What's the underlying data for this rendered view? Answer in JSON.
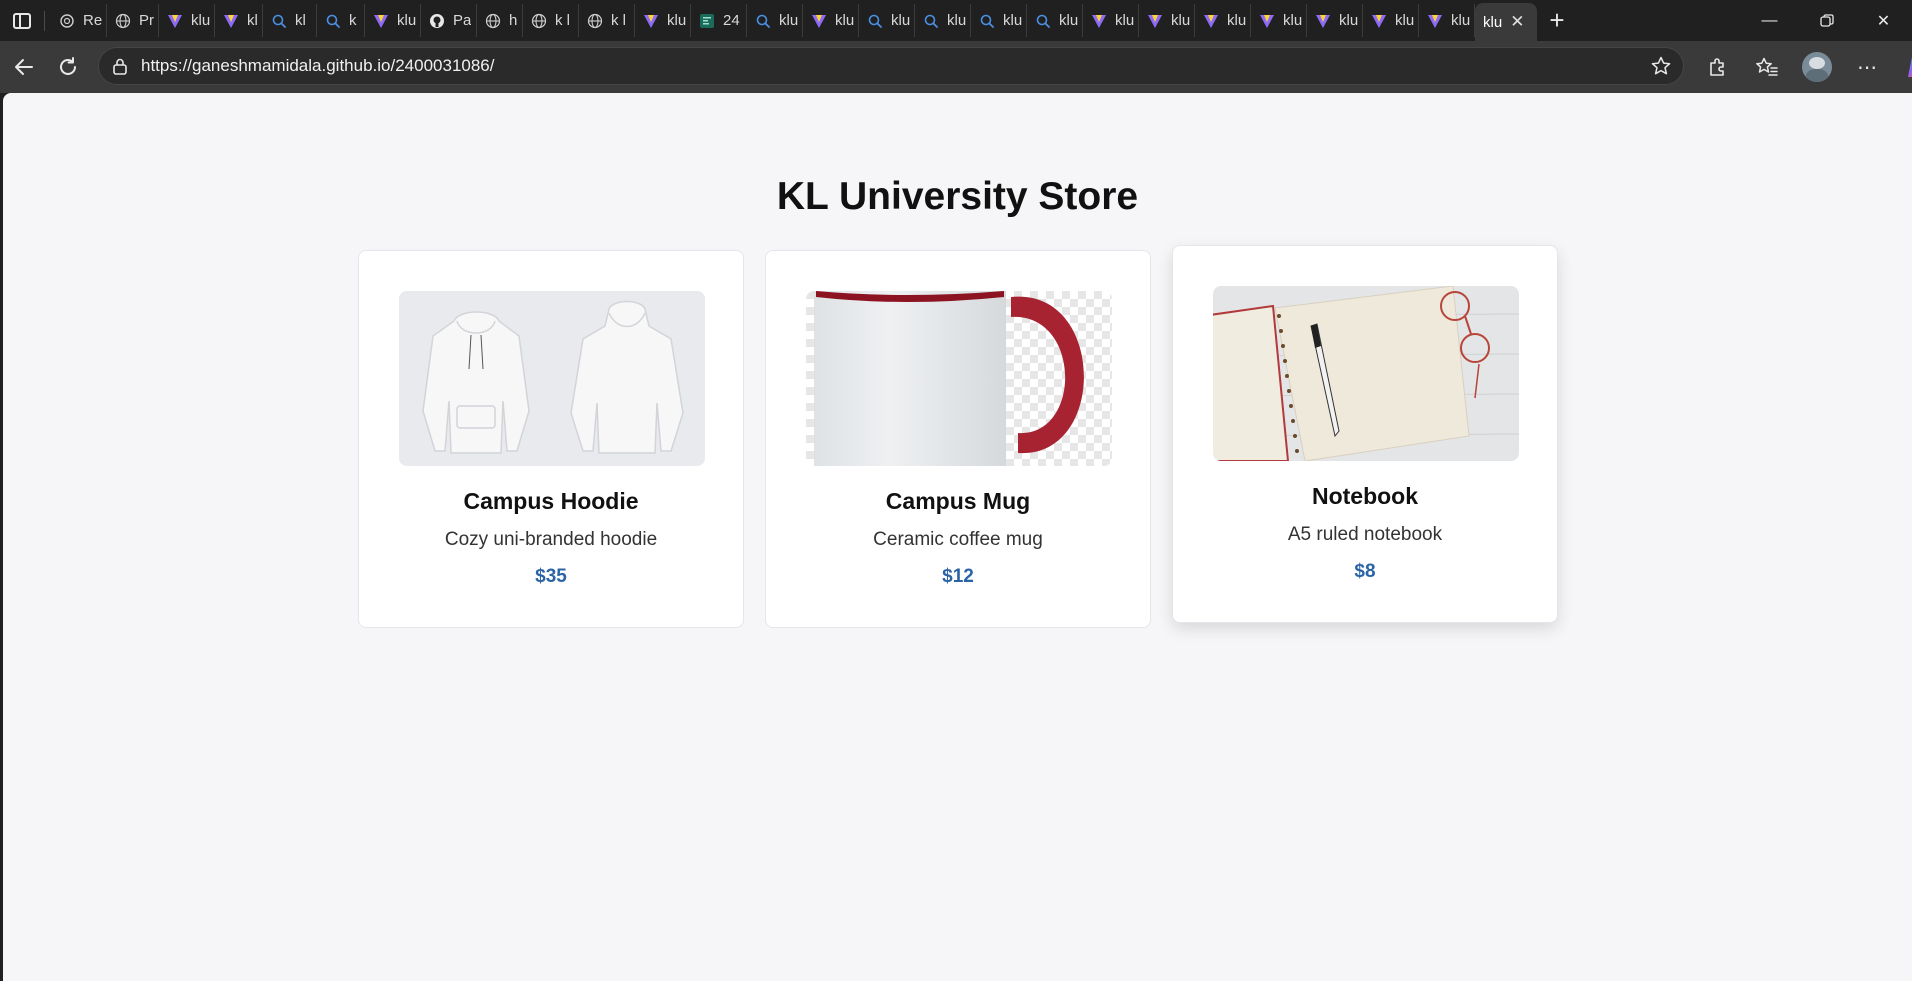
{
  "browser": {
    "tabs": [
      {
        "label": "Re",
        "icon": "openai-icon"
      },
      {
        "label": "Pro",
        "icon": "globe-icon"
      },
      {
        "label": "klu",
        "icon": "vite-icon"
      },
      {
        "label": "klu",
        "icon": "vite-icon"
      },
      {
        "label": "kl",
        "icon": "search-icon"
      },
      {
        "label": "k l",
        "icon": "search-icon"
      },
      {
        "label": "klu",
        "icon": "vite-icon"
      },
      {
        "label": "Pa",
        "icon": "github-icon"
      },
      {
        "label": "ho",
        "icon": "globe-icon"
      },
      {
        "label": "k l",
        "icon": "globe-icon"
      },
      {
        "label": "k l",
        "icon": "globe-icon"
      },
      {
        "label": "klu",
        "icon": "vite-icon"
      },
      {
        "label": "24",
        "icon": "sheet-icon"
      },
      {
        "label": "klu",
        "icon": "search-icon"
      },
      {
        "label": "klu",
        "icon": "vite-icon"
      },
      {
        "label": "klu",
        "icon": "search-icon"
      },
      {
        "label": "klu",
        "icon": "search-icon"
      },
      {
        "label": "klu",
        "icon": "search-icon"
      },
      {
        "label": "klu",
        "icon": "search-icon"
      },
      {
        "label": "klu",
        "icon": "vite-icon"
      },
      {
        "label": "klu",
        "icon": "vite-icon"
      },
      {
        "label": "klu",
        "icon": "vite-icon"
      },
      {
        "label": "klu",
        "icon": "vite-icon"
      },
      {
        "label": "klu",
        "icon": "vite-icon"
      },
      {
        "label": "klu",
        "icon": "vite-icon"
      },
      {
        "label": "klu",
        "icon": "vite-icon"
      }
    ],
    "active_tab_label": "klu",
    "url": "https://ganeshmamidala.github.io/2400031086/"
  },
  "page": {
    "title": "KL University Store",
    "products": [
      {
        "name": "Campus Hoodie",
        "description": "Cozy uni-branded hoodie",
        "price": "$35",
        "image": "hoodie-image"
      },
      {
        "name": "Campus Mug",
        "description": "Ceramic coffee mug",
        "price": "$12",
        "image": "mug-image"
      },
      {
        "name": "Notebook",
        "description": "A5 ruled notebook",
        "price": "$8",
        "image": "notebook-image"
      }
    ]
  },
  "colors": {
    "page_bg": "#f6f6f8",
    "price": "#2b64a6",
    "browser_chrome": "#202020",
    "toolbar": "#3a3a3a"
  }
}
